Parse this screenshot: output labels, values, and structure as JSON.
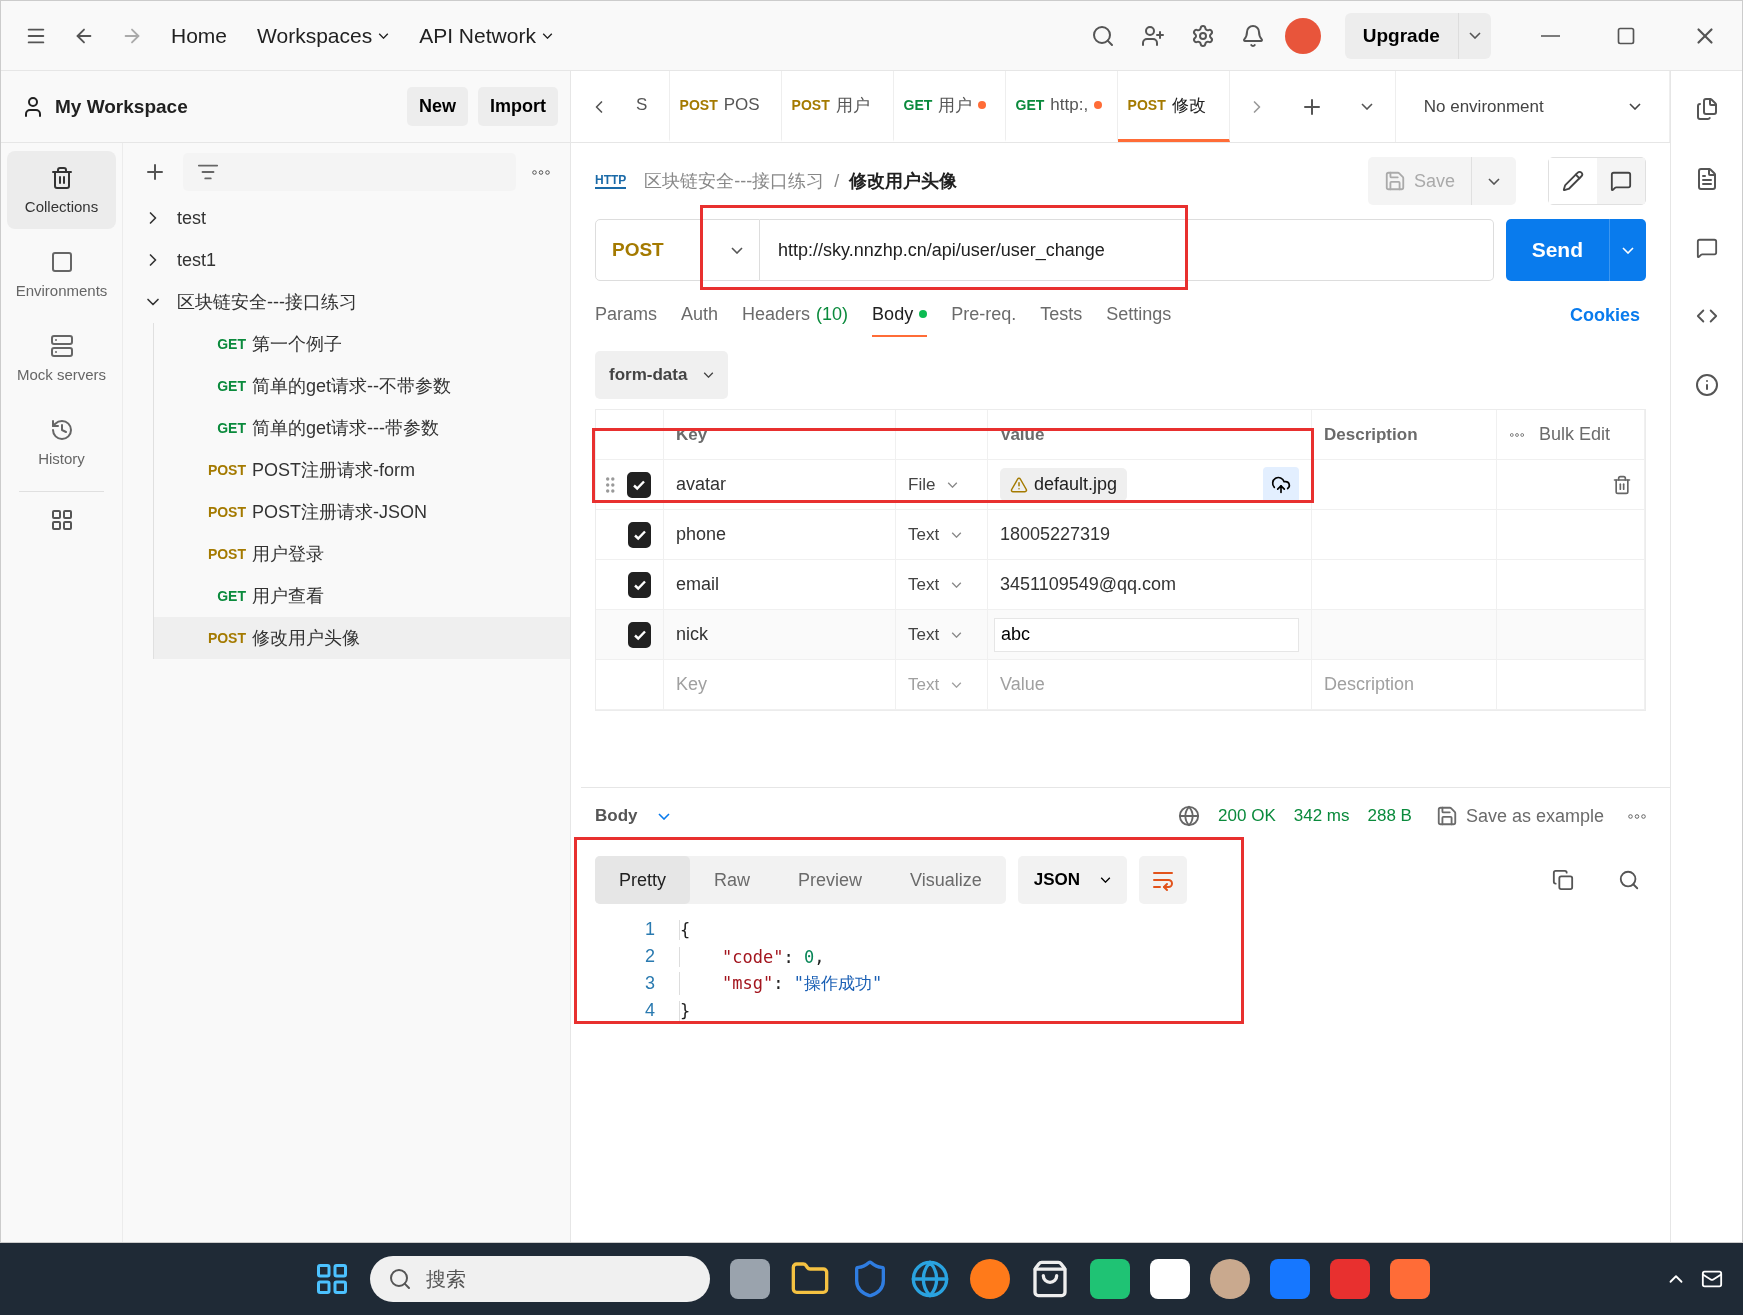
{
  "topbar": {
    "nav": [
      {
        "label": "Home",
        "dropdown": false
      },
      {
        "label": "Workspaces",
        "dropdown": true
      },
      {
        "label": "API Network",
        "dropdown": true
      }
    ],
    "upgrade": "Upgrade"
  },
  "sidebar": {
    "title": "My Workspace",
    "buttons": [
      "New",
      "Import"
    ],
    "rail": [
      {
        "label": "Collections",
        "selected": true
      },
      {
        "label": "Environments",
        "selected": false
      },
      {
        "label": "Mock servers",
        "selected": false
      },
      {
        "label": "History",
        "selected": false
      }
    ],
    "tree": [
      {
        "name": "test",
        "expanded": false
      },
      {
        "name": "test1",
        "expanded": false
      },
      {
        "name": "区块链安全---接口练习",
        "expanded": true,
        "children": [
          {
            "method": "GET",
            "name": "第一个例子",
            "selected": false
          },
          {
            "method": "GET",
            "name": "简单的get请求--不带参数",
            "selected": false
          },
          {
            "method": "GET",
            "name": "简单的get请求---带参数",
            "selected": false
          },
          {
            "method": "POST",
            "name": "POST注册请求-form",
            "selected": false
          },
          {
            "method": "POST",
            "name": "POST注册请求-JSON",
            "selected": false
          },
          {
            "method": "POST",
            "name": "用户登录",
            "selected": false
          },
          {
            "method": "GET",
            "name": "用户查看",
            "selected": false
          },
          {
            "method": "POST",
            "name": "修改用户头像",
            "selected": true
          }
        ]
      }
    ]
  },
  "tabs": [
    {
      "label": "S",
      "selected": false,
      "unsaved": false
    },
    {
      "method": "POST",
      "label": "POS",
      "selected": false,
      "unsaved": false
    },
    {
      "method": "POST",
      "label": "用户",
      "selected": false,
      "unsaved": false
    },
    {
      "method": "GET",
      "label": "用户",
      "selected": false,
      "unsaved": true
    },
    {
      "method": "GET",
      "label": "http:,",
      "selected": false,
      "unsaved": true
    },
    {
      "method": "POST",
      "label": "修改",
      "selected": true,
      "unsaved": false
    }
  ],
  "environment": "No environment",
  "breadcrumb": {
    "badge": "HTTP",
    "collection": "区块链安全---接口练习",
    "separator": "/",
    "request": "修改用户头像"
  },
  "save": "Save",
  "request": {
    "method": "POST",
    "url": "http://sky.nnzhp.cn/api/user/user_change",
    "send": "Send"
  },
  "request_tabs": [
    {
      "label": "Params",
      "selected": false
    },
    {
      "label": "Auth",
      "selected": false
    },
    {
      "label": "Headers",
      "count": "(10)",
      "selected": false
    },
    {
      "label": "Body",
      "selected": true,
      "dot": true
    },
    {
      "label": "Pre-req.",
      "selected": false
    },
    {
      "label": "Tests",
      "selected": false
    },
    {
      "label": "Settings",
      "selected": false
    }
  ],
  "cookies": "Cookies",
  "body_mode": "form-data",
  "table": {
    "columns": [
      "Key",
      "Value",
      "Description"
    ],
    "bulk_edit": "Bulk Edit",
    "rows": [
      {
        "key": "avatar",
        "type": "File",
        "value": "default.jpg",
        "kind": "file",
        "checked": true
      },
      {
        "key": "phone",
        "type": "Text",
        "value": "18005227319",
        "kind": "text",
        "checked": true
      },
      {
        "key": "email",
        "type": "Text",
        "value": "3451109549@qq.com",
        "kind": "text",
        "checked": true
      },
      {
        "key": "nick",
        "type": "Text",
        "value": "abc",
        "kind": "input",
        "checked": true
      }
    ],
    "new_row": {
      "key": "Key",
      "type": "Text",
      "value": "Value",
      "description": "Description"
    }
  },
  "response": {
    "label": "Body",
    "status": "200 OK",
    "time": "342 ms",
    "size": "288 B",
    "save_example": "Save as example",
    "views": [
      {
        "label": "Pretty",
        "selected": true
      },
      {
        "label": "Raw",
        "selected": false
      },
      {
        "label": "Preview",
        "selected": false
      },
      {
        "label": "Visualize",
        "selected": false
      }
    ],
    "format": "JSON",
    "code": [
      {
        "number": "1",
        "tokens": [
          {
            "text": "{",
            "kind": "punct"
          }
        ]
      },
      {
        "number": "2",
        "tokens": [
          {
            "text": "\"code\"",
            "kind": "key"
          },
          {
            "text": ": ",
            "kind": "punct"
          },
          {
            "text": "0",
            "kind": "number"
          },
          {
            "text": ",",
            "kind": "punct"
          }
        ]
      },
      {
        "number": "3",
        "tokens": [
          {
            "text": "\"msg\"",
            "kind": "key"
          },
          {
            "text": ": ",
            "kind": "punct"
          },
          {
            "text": "\"操作成功\"",
            "kind": "string"
          }
        ]
      },
      {
        "number": "4",
        "tokens": [
          {
            "text": "}",
            "kind": "punct"
          }
        ]
      }
    ]
  },
  "taskbar": {
    "search_placeholder": "搜索"
  }
}
